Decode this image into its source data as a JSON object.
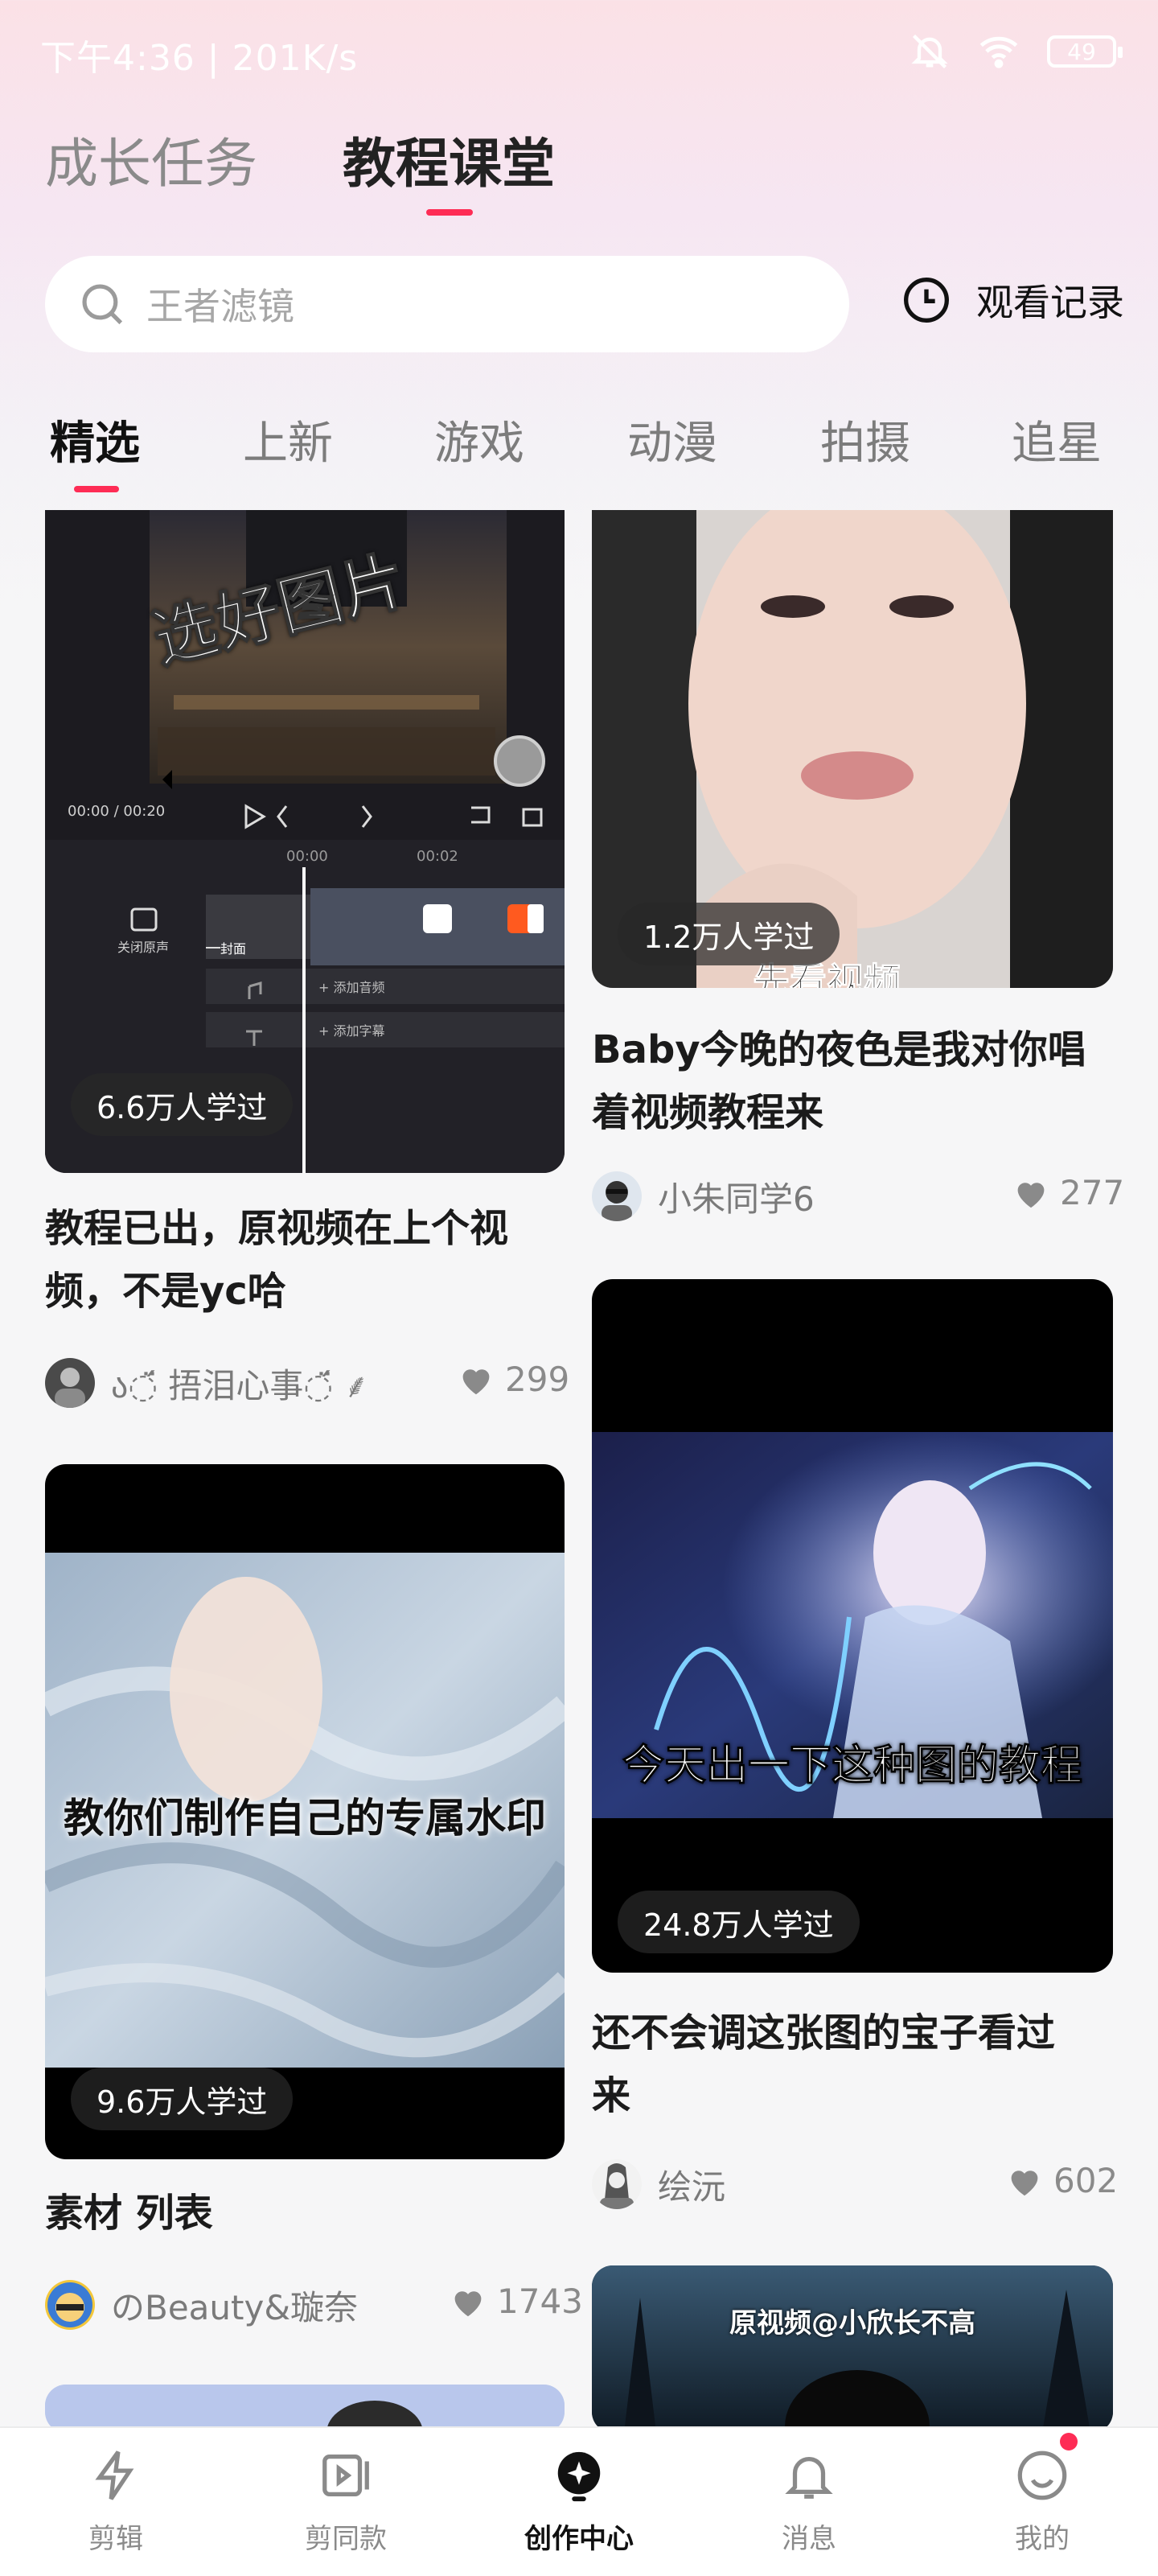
{
  "status_bar": {
    "time": "下午4:36 | 201K/s",
    "battery": "49"
  },
  "top_tabs": [
    {
      "label": "成长任务",
      "active": false
    },
    {
      "label": "教程课堂",
      "active": true
    }
  ],
  "search": {
    "placeholder": "王者滤镜",
    "history_label": "观看记录"
  },
  "categories": [
    "精选",
    "上新",
    "游戏",
    "动漫",
    "拍摄",
    "追星"
  ],
  "cards": {
    "left": [
      {
        "learners": "6.6万人学过",
        "title_line1": "教程已出，原视频在上个视",
        "title_line2": "频，不是yc哈",
        "author": "ა◌̈́ 捂泪心事◌̈́ ⸙",
        "likes": "299",
        "image_text": "选好图片",
        "editor_time": "00:00 / 00:20",
        "editor_labels": [
          "关闭原声",
          "封面",
          "+ 添加音频",
          "+ 添加字幕"
        ],
        "editor_ruler": [
          "00:00",
          "00:02"
        ]
      },
      {
        "learners": "9.6万人学过",
        "title_line1": "素材 列表",
        "title_line2": "",
        "author": "のBeauty&璇奈",
        "likes": "1743",
        "image_text": "教你们制作自己的专属水印"
      }
    ],
    "right": [
      {
        "learners": "1.2万人学过",
        "title_line1": "Baby今晚的夜色是我对你唱",
        "title_line2": "着视频教程来",
        "author": "小朱同学6",
        "likes": "277",
        "image_text": "先看视频"
      },
      {
        "learners": "24.8万人学过",
        "title_line1": "还不会调这张图的宝子看过",
        "title_line2": "来",
        "author": "绘沅",
        "likes": "602",
        "image_text": "今天出一下这种图的教程"
      },
      {
        "image_text": "原视频@小欣长不高"
      }
    ]
  },
  "bottom_nav": [
    {
      "label": "剪辑",
      "icon": "lightning-icon",
      "active": false
    },
    {
      "label": "剪同款",
      "icon": "video-template-icon",
      "active": false
    },
    {
      "label": "创作中心",
      "icon": "creator-icon",
      "active": true
    },
    {
      "label": "消息",
      "icon": "bell-icon",
      "active": false
    },
    {
      "label": "我的",
      "icon": "smiley-icon",
      "active": false,
      "has_dot": true
    }
  ],
  "colors": {
    "accent": "#fe2c55",
    "text": "#1b1b1b",
    "muted": "#8a8a8a"
  }
}
